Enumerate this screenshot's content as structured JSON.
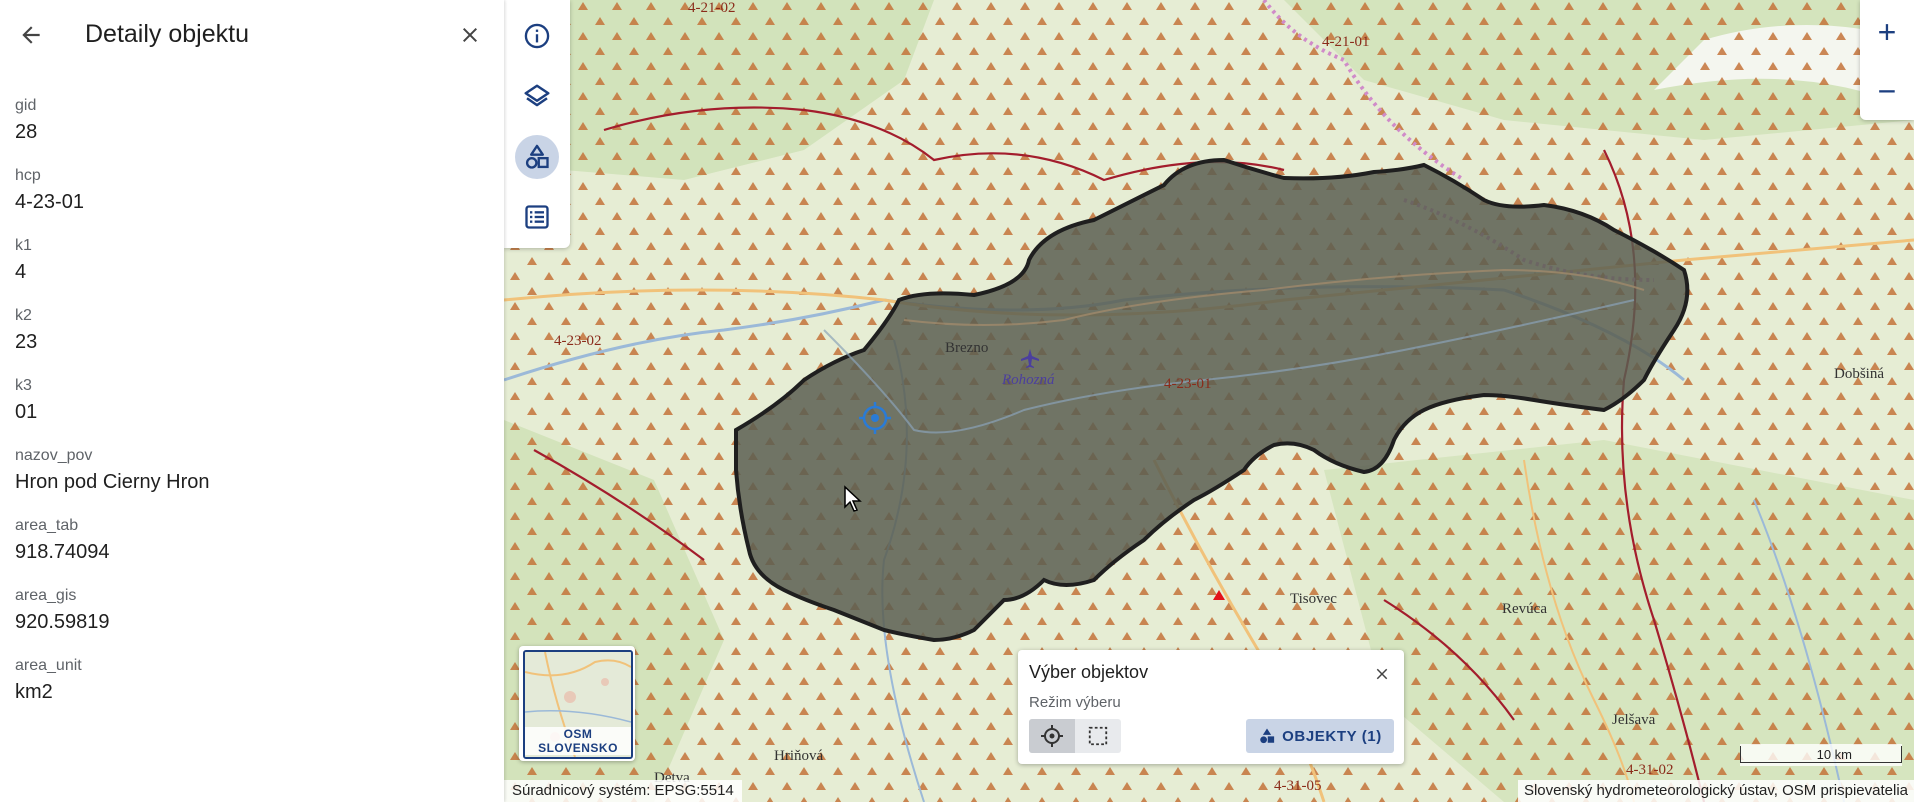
{
  "panel": {
    "title": "Detaily objektu",
    "properties": [
      {
        "key": "gid",
        "value": "28"
      },
      {
        "key": "hcp",
        "value": "4-23-01"
      },
      {
        "key": "k1",
        "value": "4"
      },
      {
        "key": "k2",
        "value": "23"
      },
      {
        "key": "k3",
        "value": "01"
      },
      {
        "key": "nazov_pov",
        "value": "Hron pod Cierny Hron"
      },
      {
        "key": "area_tab",
        "value": "918.74094"
      },
      {
        "key": "area_gis",
        "value": "920.59819"
      },
      {
        "key": "area_unit",
        "value": "km2"
      }
    ]
  },
  "toolbar": {
    "items": [
      {
        "name": "info",
        "icon": "info-icon"
      },
      {
        "name": "layers",
        "icon": "layers-icon"
      },
      {
        "name": "shapes",
        "icon": "shapes-icon",
        "active": true
      },
      {
        "name": "list",
        "icon": "list-icon"
      }
    ]
  },
  "zoom": {
    "in": "+",
    "out": "−"
  },
  "map": {
    "labels": {
      "l1": "4-21-02",
      "l2": "4-21-01",
      "l3": "4-23-02",
      "l4": "4-23-01",
      "l5": "4-31-02",
      "l6": "4-31-05"
    },
    "towns": {
      "brezno": "Brezno",
      "rohozna": "Rohozná",
      "tisovec": "Tisovec",
      "revuca": "Revúca",
      "jelsava": "Jelšava",
      "dobsina": "Dobšiná",
      "hrinova": "Hriňová",
      "detva": "Detva"
    },
    "accent": "#1c3f80",
    "selected_fill": "#5b5e51"
  },
  "basemap": {
    "label": "OSM SLOVENSKO"
  },
  "selection": {
    "title": "Výber objektov",
    "mode_label": "Režim výberu",
    "objects_button": "OBJEKTY (1)"
  },
  "scale": {
    "label": "10 km"
  },
  "footer": {
    "crs": "Súradnicový systém: EPSG:5514",
    "attribution": "Slovenský hydrometeorologický ústav, OSM prispievatelia"
  }
}
